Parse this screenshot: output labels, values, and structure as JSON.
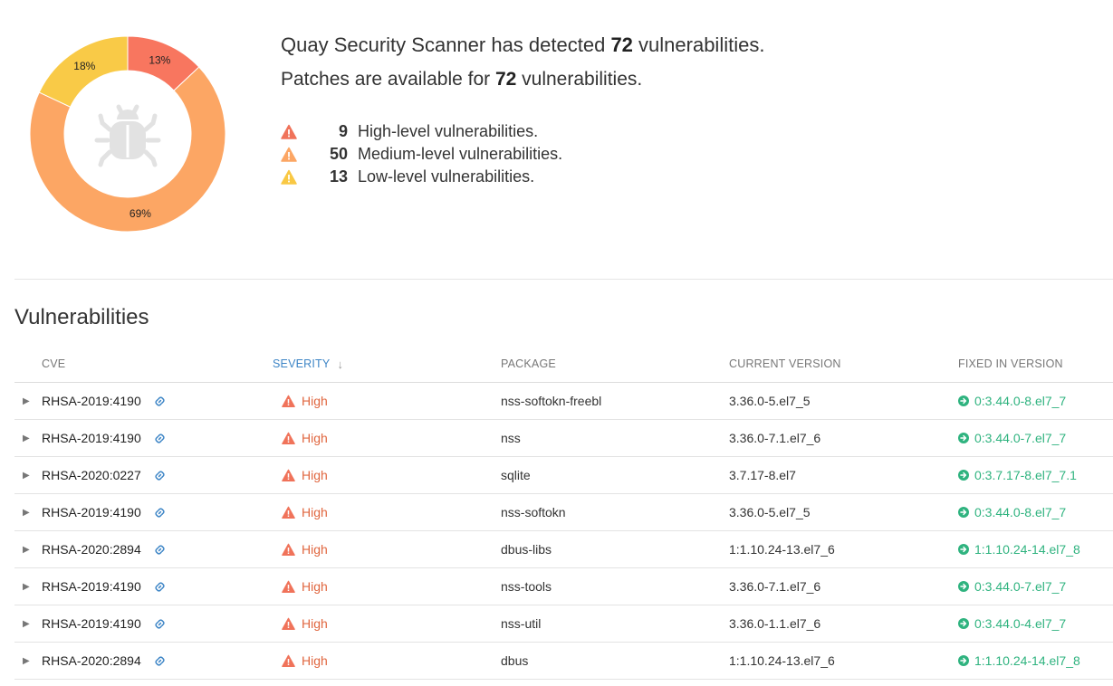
{
  "summary": {
    "detected_prefix": "Quay Security Scanner has detected ",
    "detected_count": "72",
    "detected_suffix": " vulnerabilities.",
    "patches_prefix": "Patches are available for ",
    "patches_count": "72",
    "patches_suffix": " vulnerabilities."
  },
  "severity_breakdown": [
    {
      "count": "9",
      "label": "High-level vulnerabilities.",
      "color": "#f0735a"
    },
    {
      "count": "50",
      "label": "Medium-level vulnerabilities.",
      "color": "#fca664"
    },
    {
      "count": "13",
      "label": "Low-level vulnerabilities.",
      "color": "#f9c844"
    }
  ],
  "donut": {
    "slices": [
      {
        "label": "13%",
        "percent": 13,
        "color": "#f8765f"
      },
      {
        "label": "69%",
        "percent": 69,
        "color": "#fca664"
      },
      {
        "label": "18%",
        "percent": 18,
        "color": "#f9ca47"
      }
    ],
    "center_icon": "bug-icon",
    "center_icon_color": "#e2e2e2"
  },
  "section_title": "Vulnerabilities",
  "table": {
    "headers": {
      "cve": "CVE",
      "severity": "SEVERITY",
      "sort_indicator": "↓",
      "package": "PACKAGE",
      "current_version": "CURRENT VERSION",
      "fixed_in_version": "FIXED IN VERSION"
    },
    "rows": [
      {
        "cve": "RHSA-2019:4190",
        "severity": "High",
        "package": "nss-softokn-freebl",
        "current": "3.36.0-5.el7_5",
        "fixed": "0:3.44.0-8.el7_7"
      },
      {
        "cve": "RHSA-2019:4190",
        "severity": "High",
        "package": "nss",
        "current": "3.36.0-7.1.el7_6",
        "fixed": "0:3.44.0-7.el7_7"
      },
      {
        "cve": "RHSA-2020:0227",
        "severity": "High",
        "package": "sqlite",
        "current": "3.7.17-8.el7",
        "fixed": "0:3.7.17-8.el7_7.1"
      },
      {
        "cve": "RHSA-2019:4190",
        "severity": "High",
        "package": "nss-softokn",
        "current": "3.36.0-5.el7_5",
        "fixed": "0:3.44.0-8.el7_7"
      },
      {
        "cve": "RHSA-2020:2894",
        "severity": "High",
        "package": "dbus-libs",
        "current": "1:1.10.24-13.el7_6",
        "fixed": "1:1.10.24-14.el7_8"
      },
      {
        "cve": "RHSA-2019:4190",
        "severity": "High",
        "package": "nss-tools",
        "current": "3.36.0-7.1.el7_6",
        "fixed": "0:3.44.0-7.el7_7"
      },
      {
        "cve": "RHSA-2019:4190",
        "severity": "High",
        "package": "nss-util",
        "current": "3.36.0-1.1.el7_6",
        "fixed": "0:3.44.0-4.el7_7"
      },
      {
        "cve": "RHSA-2020:2894",
        "severity": "High",
        "package": "dbus",
        "current": "1:1.10.24-13.el7_6",
        "fixed": "1:1.10.24-14.el7_8"
      }
    ]
  },
  "colors": {
    "high": "#e0663f",
    "fixed": "#2fb37f",
    "link": "#3d85c6",
    "sorted_header": "#3d85c6"
  }
}
